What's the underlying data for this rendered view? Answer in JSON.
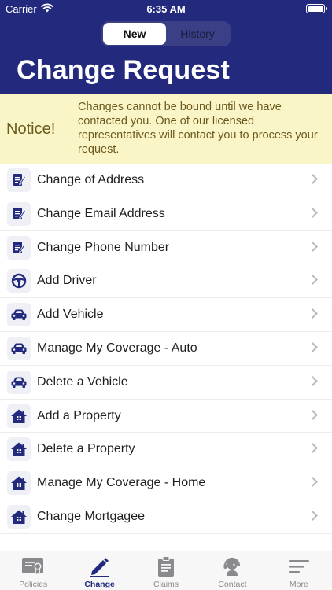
{
  "status_bar": {
    "carrier": "Carrier",
    "time": "6:35 AM"
  },
  "segmented": {
    "new_label": "New",
    "history_label": "History"
  },
  "page_title": "Change Request",
  "notice": {
    "label": "Notice!",
    "text": "Changes cannot be bound until we have contacted you. One of our licensed representatives will contact you to process your request."
  },
  "items": [
    {
      "label": "Change of Address",
      "icon": "edit-document-icon"
    },
    {
      "label": "Change Email Address",
      "icon": "edit-document-icon"
    },
    {
      "label": "Change Phone Number",
      "icon": "edit-document-icon"
    },
    {
      "label": "Add Driver",
      "icon": "steering-wheel-icon"
    },
    {
      "label": "Add Vehicle",
      "icon": "car-icon"
    },
    {
      "label": "Manage My Coverage - Auto",
      "icon": "car-icon"
    },
    {
      "label": "Delete a Vehicle",
      "icon": "car-icon"
    },
    {
      "label": "Add a Property",
      "icon": "house-icon"
    },
    {
      "label": "Delete a Property",
      "icon": "house-icon"
    },
    {
      "label": "Manage My Coverage - Home",
      "icon": "house-icon"
    },
    {
      "label": "Change Mortgagee",
      "icon": "house-icon"
    }
  ],
  "tabs": [
    {
      "label": "Policies",
      "icon": "policy-certificate-icon"
    },
    {
      "label": "Change",
      "icon": "pencil-icon"
    },
    {
      "label": "Claims",
      "icon": "clipboard-icon"
    },
    {
      "label": "Contact",
      "icon": "headset-icon"
    },
    {
      "label": "More",
      "icon": "menu-lines-icon"
    }
  ],
  "colors": {
    "brand": "#232a7d",
    "notice_bg": "#faf5c7",
    "notice_text": "#6b5a1e"
  }
}
